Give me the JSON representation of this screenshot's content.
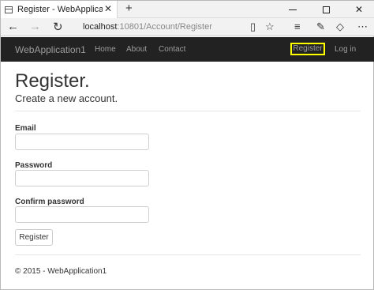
{
  "browser": {
    "tab_title": "Register - WebApplicati",
    "tab_close": "✕",
    "new_tab": "+",
    "url_host": "localhost",
    "url_rest": ":10801/Account/Register"
  },
  "navbar": {
    "brand": "WebApplication1",
    "links": [
      "Home",
      "About",
      "Contact"
    ],
    "register": "Register",
    "login": "Log in",
    "highlight_color": "#ffff00",
    "background": "#222222"
  },
  "page": {
    "title": "Register.",
    "subtitle": "Create a new account.",
    "fields": {
      "email_label": "Email",
      "password_label": "Password",
      "confirm_label": "Confirm password"
    },
    "submit": "Register",
    "footer": "© 2015 - WebApplication1"
  }
}
